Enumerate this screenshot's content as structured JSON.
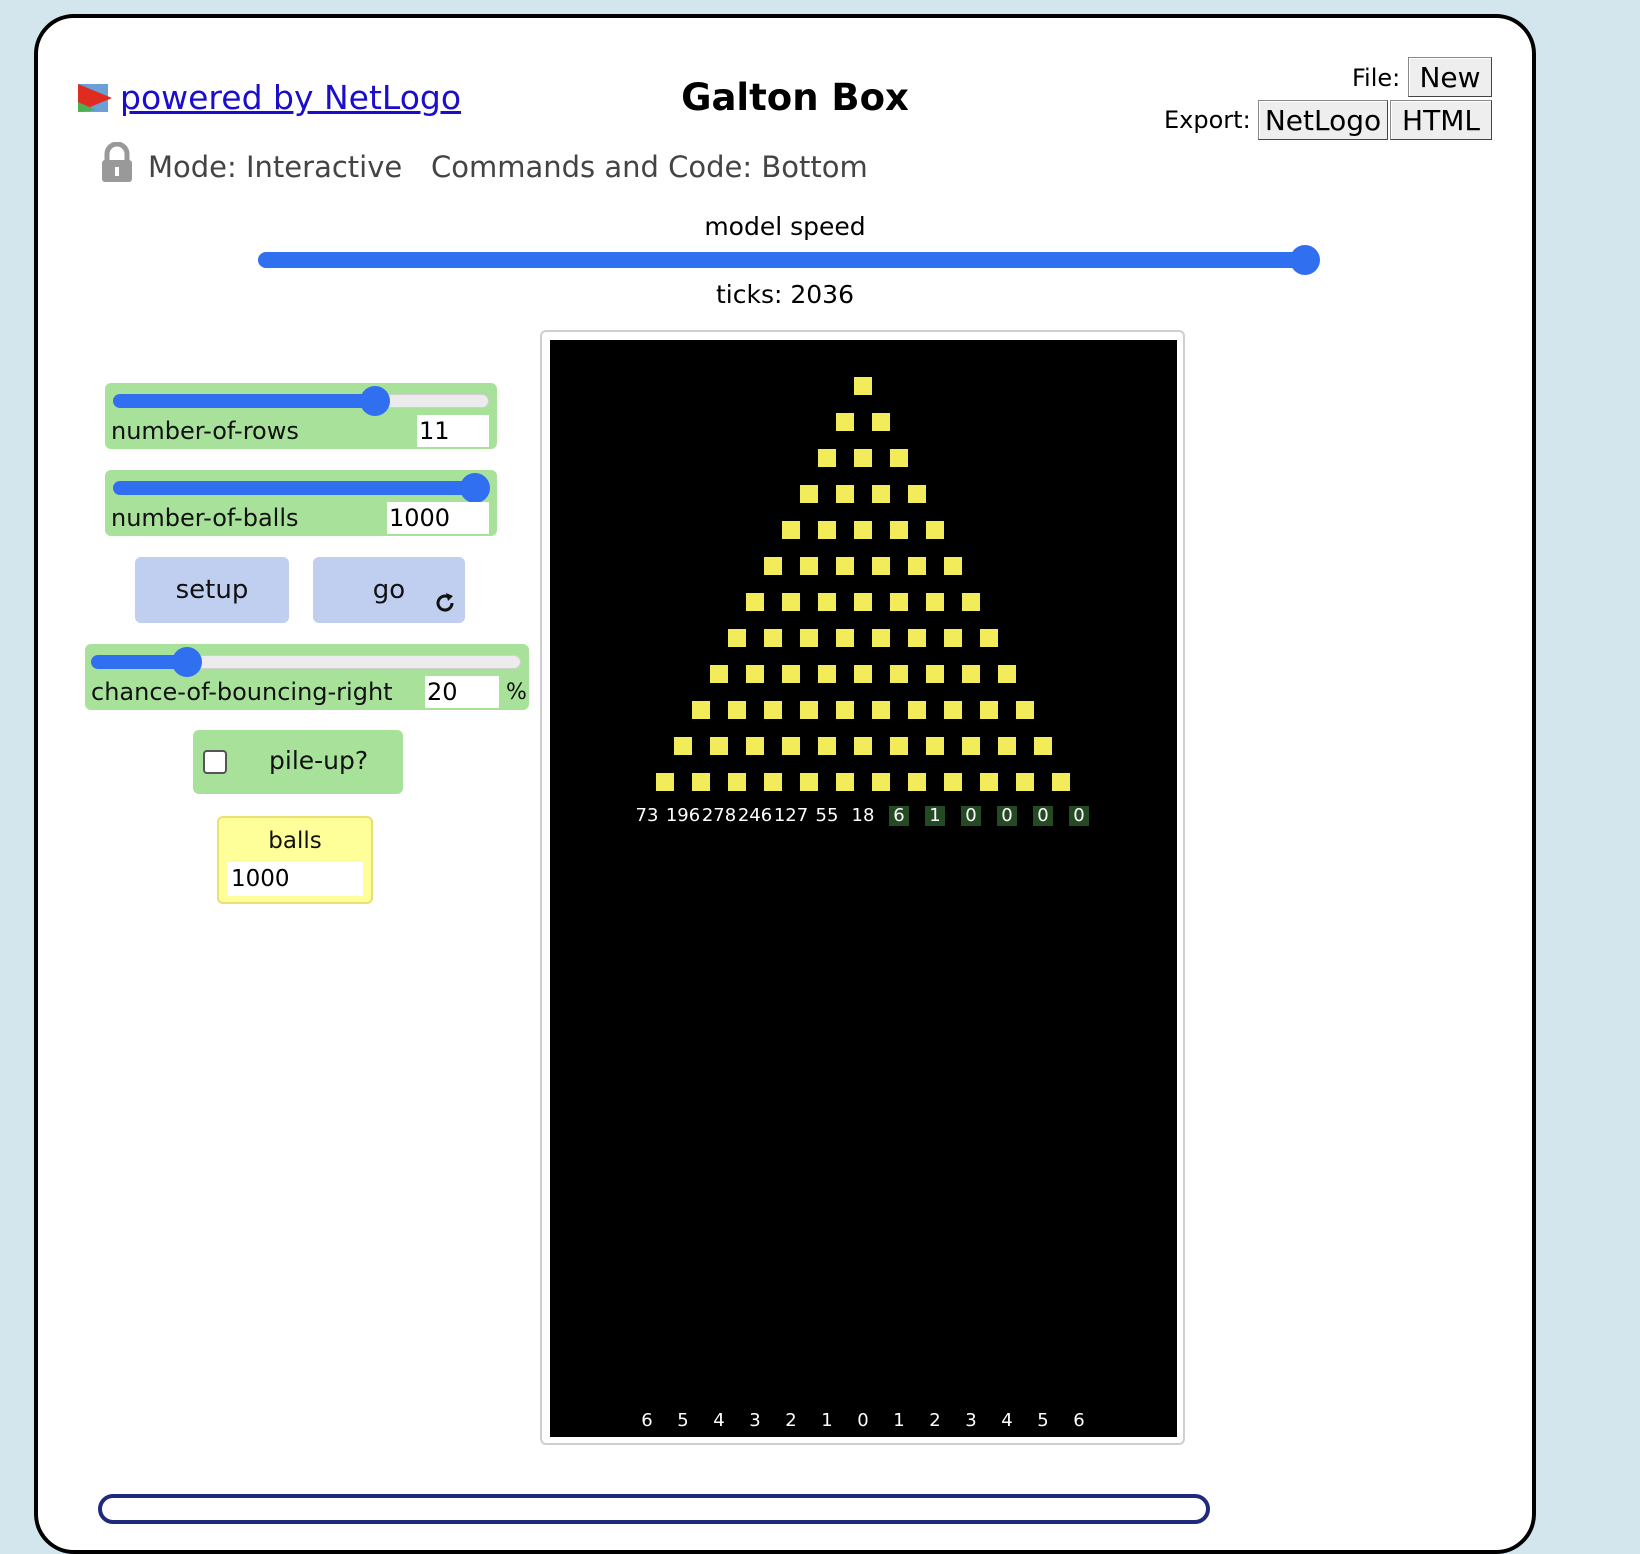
{
  "header": {
    "powered_by": "powered by NetLogo",
    "title": "Galton Box",
    "file_label": "File:",
    "new_button": "New",
    "export_label": "Export:",
    "export_netlogo": "NetLogo",
    "export_html": "HTML",
    "mode_text": "Mode: Interactive",
    "commands_text": "Commands and Code: Bottom"
  },
  "speed": {
    "label": "model speed",
    "ticks_text": "ticks: 2036",
    "level": 1.0
  },
  "sliders": [
    {
      "name": "number-of-rows",
      "value": "11",
      "fraction": 0.69
    },
    {
      "name": "number-of-balls",
      "value": "1000",
      "fraction": 1.0
    },
    {
      "name": "chance-of-bouncing-right",
      "value": "20",
      "units": "%",
      "fraction": 0.2
    }
  ],
  "buttons": {
    "setup": "setup",
    "go": "go"
  },
  "switch": {
    "label": "pile-up?",
    "on": false
  },
  "monitor": {
    "label": "balls",
    "value": "1000"
  },
  "view": {
    "peg_color": "#f2ec5a",
    "rows": 12,
    "bin_counts": [
      "73",
      "196",
      "278",
      "246",
      "127",
      "55",
      "18",
      "6",
      "1",
      "0",
      "0",
      "0",
      "0"
    ],
    "bin_indices": [
      "6",
      "5",
      "4",
      "3",
      "2",
      "1",
      "0",
      "1",
      "2",
      "3",
      "4",
      "5",
      "6"
    ]
  },
  "colors": {
    "background": "#d3e6ee",
    "slider_green": "#a8e29a",
    "button_blue": "#c0cff0",
    "accent_blue": "#2f6ff0",
    "monitor_yellow": "#ffff99",
    "link_blue": "#1a0dcc"
  }
}
